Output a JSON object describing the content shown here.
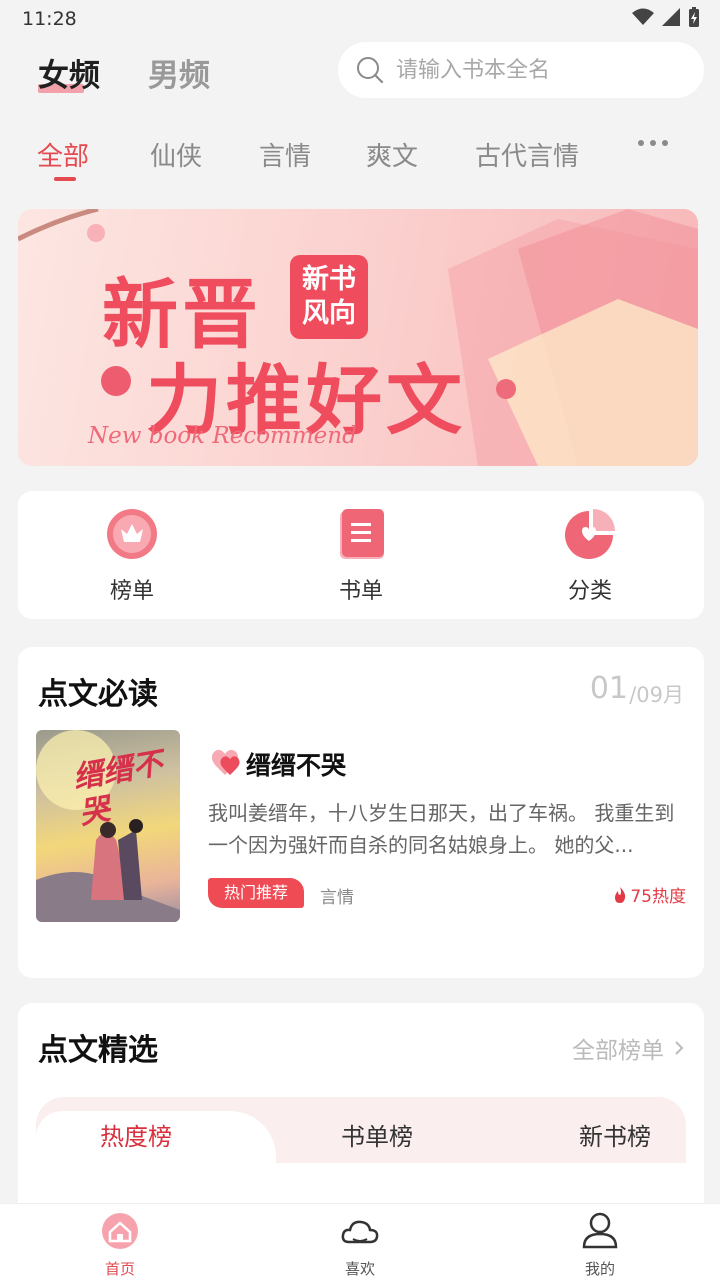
{
  "status": {
    "time": "11:28"
  },
  "header": {
    "gender_tabs": [
      {
        "label": "女频",
        "active": true
      },
      {
        "label": "男频",
        "active": false
      }
    ],
    "search": {
      "placeholder": "请输入书本全名",
      "value": ""
    }
  },
  "categories": [
    {
      "label": "全部",
      "active": true
    },
    {
      "label": "仙侠"
    },
    {
      "label": "言情"
    },
    {
      "label": "爽文"
    },
    {
      "label": "古代言情"
    }
  ],
  "banner": {
    "line1": "新晋",
    "badge_line1": "新书",
    "badge_line2": "风向",
    "line2": "力推好文",
    "subtitle": "New book Recommend"
  },
  "quick_entries": [
    {
      "label": "榜单",
      "icon": "crown-icon"
    },
    {
      "label": "书单",
      "icon": "booklist-icon"
    },
    {
      "label": "分类",
      "icon": "category-pie-icon"
    }
  ],
  "must_read": {
    "title": "点文必读",
    "date_day": "01",
    "date_month": "/09月",
    "book": {
      "cover_title": "缙缙不哭",
      "name": "缙缙不哭",
      "description": "我叫姜缙年，十八岁生日那天，出了车祸。 我重生到一个因为强奸而自杀的同名姑娘身上。 她的父...",
      "tag": "热门推荐",
      "genre": "言情",
      "heat": "75热度"
    }
  },
  "selection": {
    "title": "点文精选",
    "all_link": "全部榜单",
    "tabs": [
      {
        "label": "热度榜",
        "active": true
      },
      {
        "label": "书单榜"
      },
      {
        "label": "新书榜"
      }
    ]
  },
  "bottom_nav": [
    {
      "label": "首页",
      "icon": "home-icon",
      "active": true
    },
    {
      "label": "喜欢",
      "icon": "cloud-icon"
    },
    {
      "label": "我的",
      "icon": "user-icon"
    }
  ],
  "colors": {
    "accent": "#e44a50",
    "background": "#f3f3f3"
  }
}
